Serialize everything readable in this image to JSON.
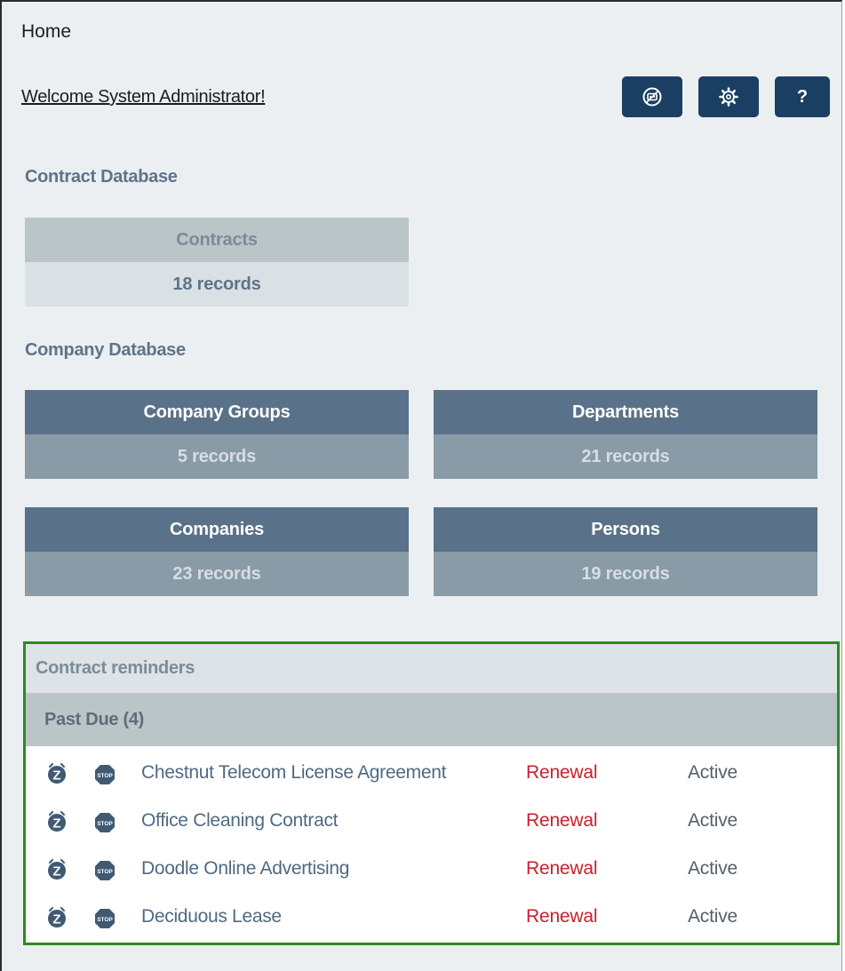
{
  "header": {
    "breadcrumb": "Home",
    "welcome": "Welcome System Administrator!",
    "buttons": [
      {
        "icon": "bot-icon"
      },
      {
        "icon": "gear-icon"
      },
      {
        "label": "?",
        "icon": "help-icon"
      }
    ]
  },
  "contract_db": {
    "title": "Contract Database",
    "tiles": [
      {
        "name": "Contracts",
        "count": "18 records"
      }
    ]
  },
  "company_db": {
    "title": "Company Database",
    "tiles": [
      {
        "name": "Company Groups",
        "count": "5 records"
      },
      {
        "name": "Departments",
        "count": "21 records"
      },
      {
        "name": "Companies",
        "count": "23 records"
      },
      {
        "name": "Persons",
        "count": "19 records"
      }
    ]
  },
  "reminders": {
    "title": "Contract reminders",
    "group": "Past Due (4)",
    "items": [
      {
        "title": "Chestnut Telecom License Agreement",
        "type": "Renewal",
        "status": "Active"
      },
      {
        "title": "Office Cleaning Contract",
        "type": "Renewal",
        "status": "Active"
      },
      {
        "title": "Doodle Online Advertising",
        "type": "Renewal",
        "status": "Active"
      },
      {
        "title": "Deciduous Lease",
        "type": "Renewal",
        "status": "Active"
      }
    ],
    "icon_labels": {
      "stop": "STOP",
      "snooze": "Z"
    }
  },
  "colors": {
    "accent": "#1a3f63",
    "highlight_border": "#2e8a1c",
    "renewal": "#c8202e",
    "link": "#4e6a83"
  }
}
